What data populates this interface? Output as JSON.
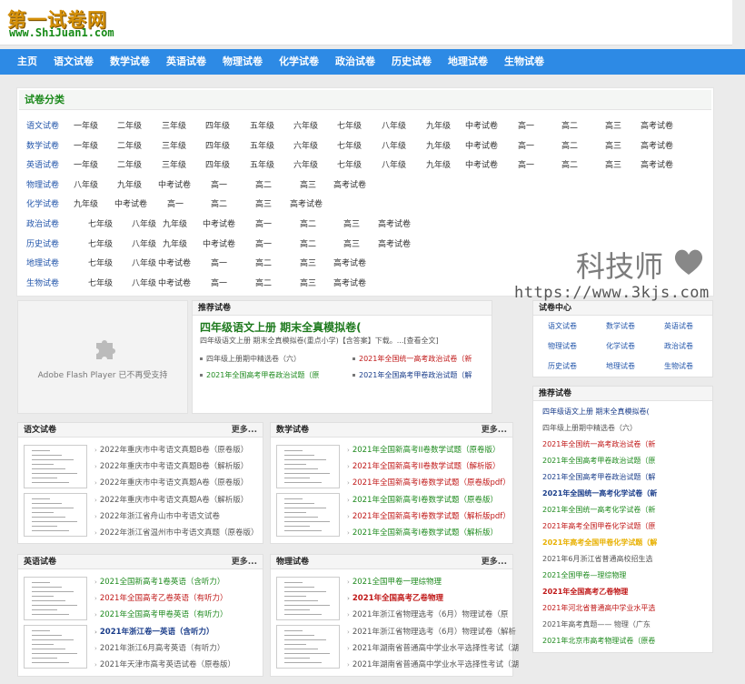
{
  "logo": {
    "cn": "第一试卷网",
    "url": "www.ShiJuan1.com"
  },
  "nav": [
    "主页",
    "语文试卷",
    "数学试卷",
    "英语试卷",
    "物理试卷",
    "化学试卷",
    "政治试卷",
    "历史试卷",
    "地理试卷",
    "生物试卷"
  ],
  "category": {
    "title": "试卷分类",
    "rows": [
      {
        "name": "语文试卷",
        "items": [
          "一年级",
          "二年级",
          "三年级",
          "四年级",
          "五年级",
          "六年级",
          "七年级",
          "八年级",
          "九年级",
          "中考试卷",
          "高一",
          "高二",
          "高三",
          "高考试卷"
        ]
      },
      {
        "name": "数学试卷",
        "items": [
          "一年级",
          "二年级",
          "三年级",
          "四年级",
          "五年级",
          "六年级",
          "七年级",
          "八年级",
          "九年级",
          "中考试卷",
          "高一",
          "高二",
          "高三",
          "高考试卷"
        ]
      },
      {
        "name": "英语试卷",
        "items": [
          "一年级",
          "二年级",
          "三年级",
          "四年级",
          "五年级",
          "六年级",
          "七年级",
          "八年级",
          "九年级",
          "中考试卷",
          "高一",
          "高二",
          "高三",
          "高考试卷"
        ]
      },
      {
        "name": "物理试卷",
        "items": [
          "八年级",
          "九年级",
          "中考试卷",
          "高一",
          "高二",
          "高三",
          "高考试卷"
        ]
      },
      {
        "name": "化学试卷",
        "items": [
          "九年级",
          "中考试卷",
          "高一",
          "高二",
          "高三",
          "高考试卷"
        ]
      },
      {
        "name": "政治试卷",
        "items": [
          "七年级",
          "八年级",
          "九年级",
          "中考试卷",
          "高一",
          "高二",
          "高三",
          "高考试卷"
        ]
      },
      {
        "name": "历史试卷",
        "items": [
          "七年级",
          "八年级",
          "九年级",
          "中考试卷",
          "高一",
          "高二",
          "高三",
          "高考试卷"
        ]
      },
      {
        "name": "地理试卷",
        "items": [
          "七年级",
          "八年级",
          "中考试卷",
          "高一",
          "高二",
          "高三",
          "高考试卷"
        ]
      },
      {
        "name": "生物试卷",
        "items": [
          "七年级",
          "八年级",
          "中考试卷",
          "高一",
          "高二",
          "高三",
          "高考试卷"
        ]
      }
    ]
  },
  "flash": {
    "text": "Adobe Flash Player 已不再受支持"
  },
  "recommend": {
    "title": "推荐试卷",
    "headline": "四年级语文上册 期末全真模拟卷(",
    "summary": "四年级语文上册 期末全真模拟卷(重点小学)【含答案】下载。...[查看全文]",
    "items": [
      {
        "text": "四年级上册期中精选卷（六）",
        "color": "gy"
      },
      {
        "text": "2021年全国统一高考政治试卷（新",
        "color": "r"
      },
      {
        "text": "2021年全国高考甲卷政治试题（原",
        "color": "g"
      },
      {
        "text": "2021年全国高考甲卷政治试题（解",
        "color": "b"
      }
    ]
  },
  "sections": [
    {
      "title": "语文试卷",
      "more": "更多...",
      "items": [
        {
          "text": "2022年重庆市中考语文真题B卷（原卷版）",
          "color": "gy",
          "bold": false
        },
        {
          "text": "2022年重庆市中考语文真题B卷（解析版）",
          "color": "gy",
          "bold": false
        },
        {
          "text": "2022年重庆市中考语文真题A卷（原卷版）",
          "color": "gy",
          "bold": false
        },
        {
          "text": "2022年重庆市中考语文真题A卷（解析版）",
          "color": "gy",
          "bold": false
        },
        {
          "text": "2022年浙江省舟山市中考语文试卷",
          "color": "gy",
          "bold": false
        },
        {
          "text": "2022年浙江省温州市中考语文真题（原卷版）",
          "color": "gy",
          "bold": false
        }
      ]
    },
    {
      "title": "数学试卷",
      "more": "更多...",
      "items": [
        {
          "text": "2021年全国新高考II卷数学试题（原卷版）",
          "color": "g",
          "bold": false
        },
        {
          "text": "2021年全国新高考II卷数学试题（解析版）",
          "color": "r",
          "bold": false
        },
        {
          "text": "2021年全国新高考I卷数学试题（原卷版pdf）",
          "color": "r",
          "bold": false
        },
        {
          "text": "2021年全国新高考I卷数学试题（原卷版）",
          "color": "g",
          "bold": false
        },
        {
          "text": "2021年全国新高考I卷数学试题（解析版pdf）",
          "color": "r",
          "bold": false
        },
        {
          "text": "2021年全国新高考I卷数学试题（解析版）",
          "color": "g",
          "bold": false
        }
      ]
    },
    {
      "title": "英语试卷",
      "more": "更多...",
      "items": [
        {
          "text": "2021全国新高考1卷英语（含听力）",
          "color": "g",
          "bold": false
        },
        {
          "text": "2021年全国高考乙卷英语（有听力）",
          "color": "r",
          "bold": false
        },
        {
          "text": "2021年全国高考甲卷英语（有听力）",
          "color": "g",
          "bold": false
        },
        {
          "text": "2021年浙江卷一英语（含听力）",
          "color": "b",
          "bold": true
        },
        {
          "text": "2021年浙江6月高考英语（有听力）",
          "color": "gy",
          "bold": false
        },
        {
          "text": "2021年天津市高考英语试卷（原卷版）",
          "color": "gy",
          "bold": false
        }
      ]
    },
    {
      "title": "物理试卷",
      "more": "更多...",
      "items": [
        {
          "text": "2021全国甲卷一理综物理",
          "color": "g",
          "bold": false
        },
        {
          "text": "2021年全国高考乙卷物理",
          "color": "r",
          "bold": true
        },
        {
          "text": "2021年浙江省物理选考（6月）物理试卷（原",
          "color": "gy",
          "bold": false
        },
        {
          "text": "2021年浙江省物理选考（6月）物理试卷（解析",
          "color": "gy",
          "bold": false
        },
        {
          "text": "2021年湖南省普通高中学业水平选择性考试（湖",
          "color": "gy",
          "bold": false
        },
        {
          "text": "2021年湖南省普通高中学业水平选择性考试（湖",
          "color": "gy",
          "bold": false
        }
      ]
    }
  ],
  "center": {
    "title": "试卷中心",
    "links": [
      "语文试卷",
      "数学试卷",
      "英语试卷",
      "物理试卷",
      "化学试卷",
      "政治试卷",
      "历史试卷",
      "地理试卷",
      "生物试卷"
    ]
  },
  "side_recommend": {
    "title": "推荐试卷",
    "items": [
      {
        "text": "四年级语文上册 期末全真模拟卷(",
        "color": "b",
        "bold": false
      },
      {
        "text": "四年级上册期中精选卷（六）",
        "color": "gy",
        "bold": false
      },
      {
        "text": "2021年全国统一高考政治试卷（新",
        "color": "r",
        "bold": false
      },
      {
        "text": "2021年全国高考甲卷政治试题（原",
        "color": "g",
        "bold": false
      },
      {
        "text": "2021年全国高考甲卷政治试题（解",
        "color": "b",
        "bold": false
      },
      {
        "text": "2021年全国统一高考化学试卷（新",
        "color": "b",
        "bold": true
      },
      {
        "text": "2021年全国统一高考化学试卷（新",
        "color": "g",
        "bold": false
      },
      {
        "text": "2021年高考全国甲卷化学试题（原",
        "color": "r",
        "bold": false
      },
      {
        "text": "2021年高考全国甲卷化学试题（解",
        "color": "y",
        "bold": true
      },
      {
        "text": "2021年6月浙江省普通高校招生选",
        "color": "gy",
        "bold": false
      },
      {
        "text": "2021全国甲卷—理综物理",
        "color": "g",
        "bold": false
      },
      {
        "text": "2021年全国高考乙卷物理",
        "color": "r",
        "bold": true
      },
      {
        "text": "2021年河北省普通高中学业水平选",
        "color": "r",
        "bold": false
      },
      {
        "text": "2021年高考真题—— 物理（广东",
        "color": "gy",
        "bold": false
      },
      {
        "text": "2021年北京市高考物理试卷（原卷",
        "color": "g",
        "bold": false
      }
    ]
  },
  "watermark": {
    "text": "科技师",
    "url": "https://www.3kjs.com"
  },
  "colors": {
    "nav": "#2d8ae5",
    "green": "#1e8a1e",
    "red": "#c01818",
    "blue": "#1a3d8a",
    "logo": "#d4900a"
  }
}
